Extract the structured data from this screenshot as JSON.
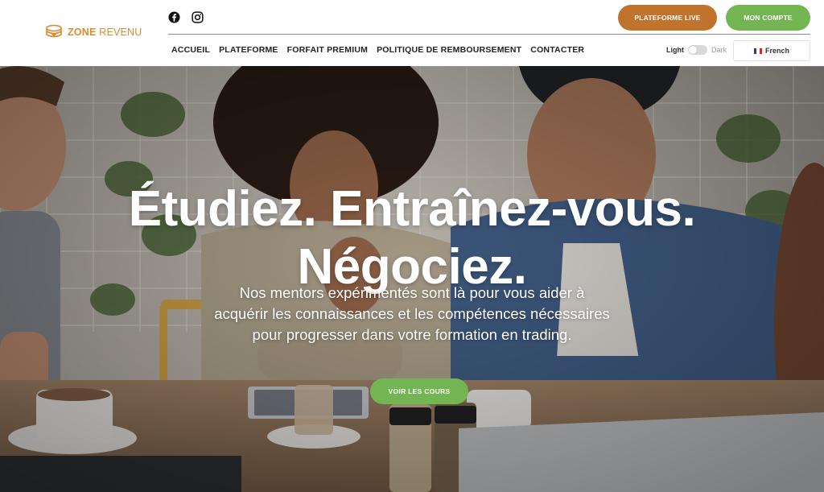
{
  "brand": {
    "name_bold": "ZONE",
    "name_light": "REVENU",
    "logo_icon": "coins-stack-logo"
  },
  "social": [
    {
      "name": "facebook-icon"
    },
    {
      "name": "instagram-icon"
    }
  ],
  "header": {
    "live_platform_label": "PLATEFORME LIVE",
    "account_label": "MON COMPTE"
  },
  "nav": {
    "items": [
      {
        "label": "ACCUEIL"
      },
      {
        "label": "PLATEFORME"
      },
      {
        "label": "FORFAIT PREMIUM"
      },
      {
        "label": "POLITIQUE DE REMBOURSEMENT"
      },
      {
        "label": "CONTACTER"
      }
    ]
  },
  "theme": {
    "light_label": "Light",
    "dark_label": "Dark",
    "mode": "light"
  },
  "language": {
    "selected": "French",
    "flag": "fr-flag-icon"
  },
  "hero": {
    "title_line1": "Étudiez. Entraînez-vous.",
    "title_line2": "Négociez.",
    "subtitle": "Nos mentors expérimentés sont là pour vous aider à acquérir les connaissances et les compétences nécessaires pour progresser dans votre formation en trading.",
    "cta_label": "VOIR LES COURS"
  },
  "colors": {
    "brand_orange": "#d98c2e",
    "live_button": "#c0732d",
    "green_button": "#72b552"
  }
}
